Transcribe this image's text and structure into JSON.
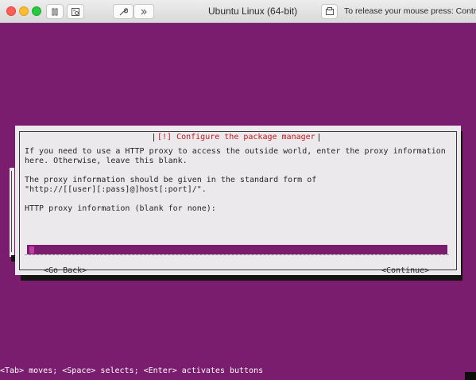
{
  "window": {
    "title": "Ubuntu Linux (64-bit)",
    "release_hint": "To release your mouse press: Control-⌘"
  },
  "toolbar": {
    "icons": [
      "pause-icon",
      "snapshot-icon",
      "wrench-icon",
      "chevron-double-right-icon",
      "screen-icon"
    ]
  },
  "dialog": {
    "title": "[!] Configure the package manager",
    "paragraph1": [
      "If you need to use a HTTP proxy to access the outside world, enter the proxy information",
      "here. Otherwise, leave this blank."
    ],
    "paragraph2": [
      "The proxy information should be given in the standard form of",
      "\"http://[[user][:pass]@]host[:port]/\"."
    ],
    "field_label": "HTTP proxy information (blank for none):",
    "field_value": "",
    "go_back": "<Go Back>",
    "continue": "<Continue>"
  },
  "status_bar": "<Tab> moves; <Space> selects; <Enter> activates buttons",
  "colors": {
    "background": "#7a1d6e",
    "dialog": "#ece9ec",
    "title_text": "#c5161b"
  }
}
